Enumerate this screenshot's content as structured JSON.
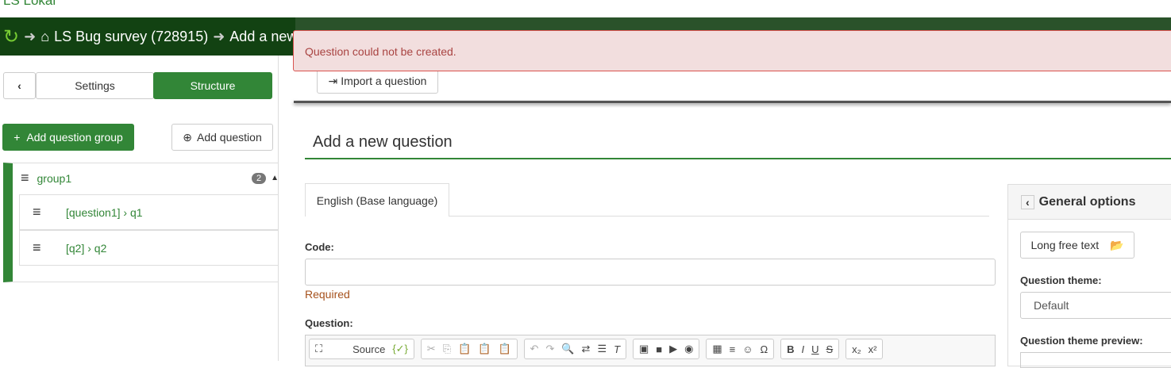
{
  "brand": "LS Lokal",
  "breadcrumb": {
    "survey": "LS Bug survey (728915)",
    "current": "Add a new question"
  },
  "alert": "Question could not be created.",
  "sidebar": {
    "settings_tab": "Settings",
    "structure_tab": "Structure",
    "add_group": "Add question group",
    "add_question": "Add question",
    "group": {
      "name": "group1",
      "count": "2",
      "questions": [
        {
          "label": "[question1] › q1"
        },
        {
          "label": "[q2] › q2"
        }
      ]
    }
  },
  "toolbar": {
    "import": "Import a question"
  },
  "main": {
    "title": "Add a new question",
    "lang_tab": "English (Base language)",
    "code_label": "Code:",
    "required": "Required",
    "question_label": "Question:",
    "source": "Source"
  },
  "options": {
    "title": "General options",
    "type": "Long free text",
    "theme_label": "Question theme:",
    "theme_value": "Default",
    "preview_label": "Question theme preview:"
  }
}
